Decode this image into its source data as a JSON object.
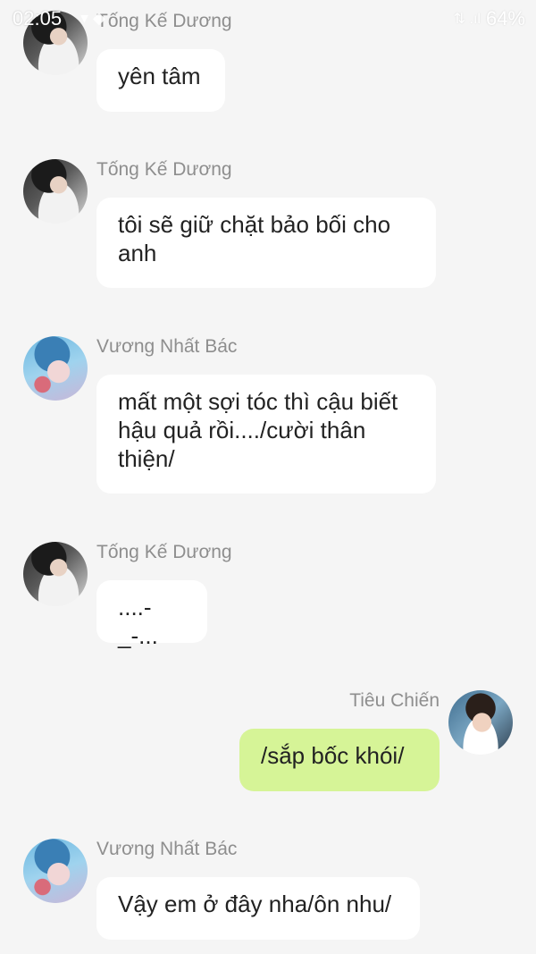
{
  "status_bar": {
    "time": "02:05",
    "icons": "▾ ◆",
    "signal": "⇅ .ıl",
    "battery": "64%"
  },
  "messages": [
    {
      "side": "left",
      "sender": "Tống Kế Dương",
      "avatar": "avatar-tong-ke-duong",
      "text": "yên tâm"
    },
    {
      "side": "left",
      "sender": "Tống Kế Dương",
      "avatar": "avatar-tong-ke-duong",
      "text": "tôi sẽ giữ chặt bảo bối cho anh"
    },
    {
      "side": "left",
      "sender": "Vương Nhất Bác",
      "avatar": "avatar-vuong-nhat-bac",
      "text": "mất một sợi tóc thì cậu biết hậu quả rồi..../cười thân thiện/"
    },
    {
      "side": "left",
      "sender": "Tống Kế Dương",
      "avatar": "avatar-tong-ke-duong",
      "text": "....-_-..."
    },
    {
      "side": "right",
      "sender": "Tiêu Chiến",
      "avatar": "avatar-tieu-chien",
      "text": "/sắp bốc khói/"
    },
    {
      "side": "left",
      "sender": "Vương Nhất Bác",
      "avatar": "avatar-vuong-nhat-bac",
      "text": "Vậy em ở đây nha/ôn nhu/"
    }
  ],
  "colors": {
    "background": "#f5f5f5",
    "bubble_incoming": "#ffffff",
    "bubble_outgoing": "#d6f497",
    "sender_name": "#8e8e8e",
    "message_text": "#222222"
  }
}
